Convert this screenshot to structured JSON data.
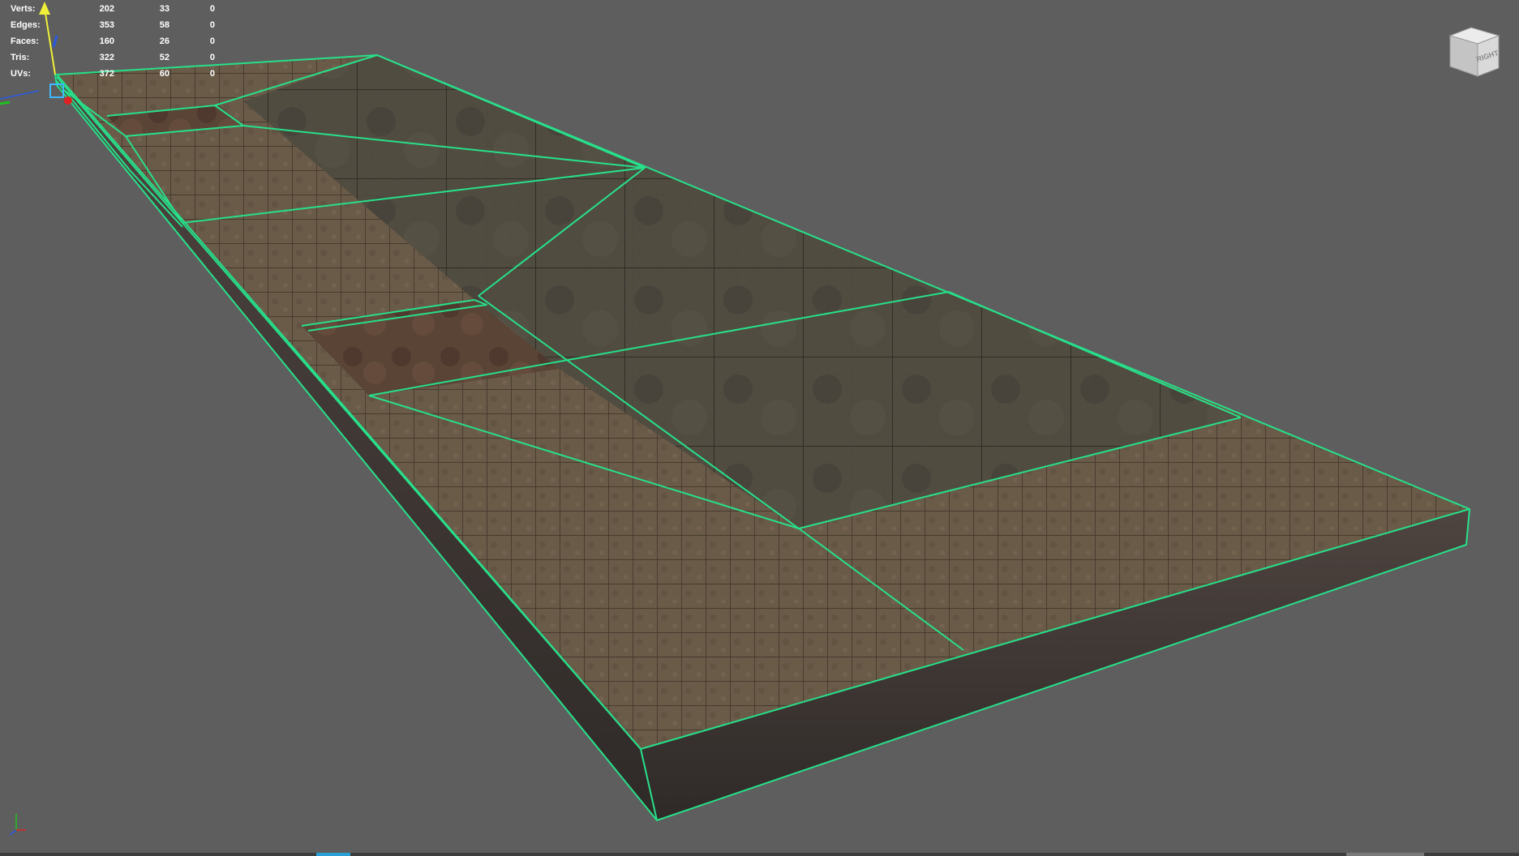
{
  "hud": {
    "rows": [
      {
        "label": "Verts:",
        "c1": "202",
        "c2": "33",
        "c3": "0"
      },
      {
        "label": "Edges:",
        "c1": "353",
        "c2": "58",
        "c3": "0"
      },
      {
        "label": "Faces:",
        "c1": "160",
        "c2": "26",
        "c3": "0"
      },
      {
        "label": "Tris:",
        "c1": "322",
        "c2": "52",
        "c3": "0"
      },
      {
        "label": "UVs:",
        "c1": "372",
        "c2": "60",
        "c3": "0"
      }
    ]
  },
  "viewcube": {
    "face_label": "RIGHT"
  },
  "colors": {
    "background": "#5e5e5e",
    "wireframe": "#27e08a",
    "axis_y": "#f0f03a",
    "axis_x": "#e02020",
    "axis_z": "#2a5ae0",
    "pivot_box": "#40b8ff"
  },
  "icons": {
    "view_axis": "xyz-axis-icon",
    "viewcube": "viewcube-icon",
    "manipulator": "move-manipulator-icon"
  }
}
